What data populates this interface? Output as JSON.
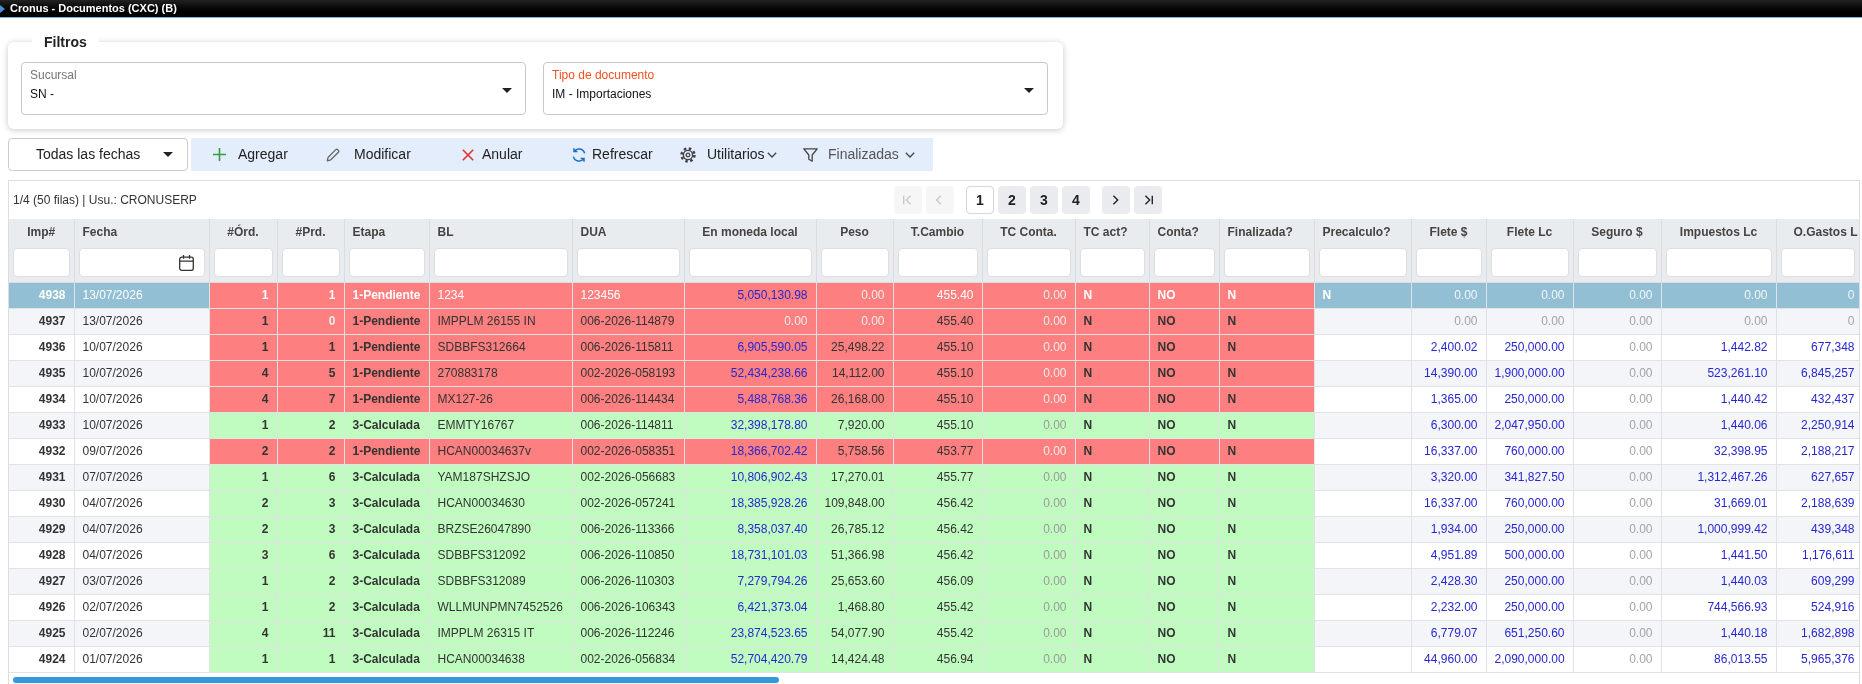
{
  "window": {
    "title": "Cronus - Documentos (CXC) (B)"
  },
  "filters": {
    "title": "Filtros",
    "fields": [
      {
        "label": "Sucursal",
        "value": "SN -",
        "focused": false
      },
      {
        "label": "Tipo de documento",
        "value": "IM - Importaciones",
        "focused": true
      }
    ]
  },
  "date_filter": {
    "value": "Todas las fechas"
  },
  "toolbar": [
    {
      "kind": "action",
      "label": "Agregar"
    },
    {
      "kind": "action",
      "label": "Modificar"
    },
    {
      "kind": "action",
      "label": "Anular"
    },
    {
      "kind": "action",
      "label": "Refrescar"
    },
    {
      "kind": "menu",
      "label": "Utilitarios"
    },
    {
      "kind": "filter",
      "label": "Finalizadas"
    }
  ],
  "table": {
    "info": "1/4 (50 filas) | Usu.: CRONUSERP",
    "pagination": {
      "first": {
        "disabled": true
      },
      "previous": {
        "disabled": true
      },
      "pages": [
        {
          "label": "1",
          "selected": true
        },
        {
          "label": "2",
          "selected": false
        },
        {
          "label": "3",
          "selected": false
        },
        {
          "label": "4",
          "selected": false
        }
      ],
      "next": {
        "disabled": false
      },
      "last": {
        "disabled": false
      }
    },
    "columns": [
      "Imp#",
      "Fecha",
      "#Órd.",
      "#Prd.",
      "Etapa",
      "BL",
      "DUA",
      "En moneda local",
      "Peso",
      "T.Cambio",
      "TC Conta.",
      "TC act?",
      "Conta?",
      "Finalizada?",
      "Precalculo?",
      "Flete $",
      "Flete Lc",
      "Seguro $",
      "Impuestos Lc",
      "O.Gastos L"
    ],
    "rows": [
      {
        "selected": true,
        "color": "#fd7f7f",
        "cells": [
          "4938",
          "13/07/2026",
          "1",
          "1",
          "1-Pendiente",
          "1234",
          "123456",
          "5,050,130.98",
          "0.00",
          "455.40",
          "0.00",
          "N",
          "NO",
          "N",
          "N",
          "0.00",
          "0.00",
          "0.00",
          "0.00",
          "0"
        ]
      },
      {
        "selected": false,
        "color": "#fd7f7f",
        "cells": [
          "4937",
          "13/07/2026",
          "1",
          "0",
          "1-Pendiente",
          "IMPPLM 26155 IN",
          "006-2026-114879",
          "0.00",
          "0.00",
          "455.40",
          "0.00",
          "N",
          "NO",
          "N",
          null,
          "0.00",
          "0.00",
          "0.00",
          "0.00",
          "0"
        ]
      },
      {
        "selected": false,
        "color": "#fd7f7f",
        "cells": [
          "4936",
          "10/07/2026",
          "1",
          "1",
          "1-Pendiente",
          "SDBBFS312664",
          "006-2026-115811",
          "6,905,590.05",
          "25,498.22",
          "455.10",
          "0.00",
          "N",
          "NO",
          "N",
          null,
          "2,400.02",
          "250,000.00",
          "0.00",
          "1,442.82",
          "677,348"
        ]
      },
      {
        "selected": false,
        "color": "#fd7f7f",
        "cells": [
          "4935",
          "10/07/2026",
          "4",
          "5",
          "1-Pendiente",
          "270883178",
          "002-2026-058193",
          "52,434,238.66",
          "14,112.00",
          "455.10",
          "0.00",
          "N",
          "NO",
          "N",
          null,
          "14,390.00",
          "1,900,000.00",
          "0.00",
          "523,261.10",
          "6,845,257"
        ]
      },
      {
        "selected": false,
        "color": "#fd7f7f",
        "cells": [
          "4934",
          "10/07/2026",
          "4",
          "7",
          "1-Pendiente",
          "MX127-26",
          "006-2026-114434",
          "5,488,768.36",
          "26,168.00",
          "455.10",
          "0.00",
          "N",
          "NO",
          "N",
          null,
          "1,365.00",
          "250,000.00",
          "0.00",
          "1,440.42",
          "432,437"
        ]
      },
      {
        "selected": false,
        "color": "#c0fcc0",
        "cells": [
          "4933",
          "10/07/2026",
          "1",
          "2",
          "3-Calculada",
          "EMMTY16767",
          "006-2026-114811",
          "32,398,178.80",
          "7,920.00",
          "455.10",
          "0.00",
          "N",
          "NO",
          "N",
          null,
          "6,300.00",
          "2,047,950.00",
          "0.00",
          "1,440.06",
          "2,250,914"
        ]
      },
      {
        "selected": false,
        "color": "#fd7f7f",
        "cells": [
          "4932",
          "09/07/2026",
          "2",
          "2",
          "1-Pendiente",
          "HCAN00034637v",
          "002-2026-058351",
          "18,366,702.42",
          "5,758.56",
          "453.77",
          "0.00",
          "N",
          "NO",
          "N",
          null,
          "16,337.00",
          "760,000.00",
          "0.00",
          "32,398.95",
          "2,188,217"
        ]
      },
      {
        "selected": false,
        "color": "#c0fcc0",
        "cells": [
          "4931",
          "07/07/2026",
          "1",
          "6",
          "3-Calculada",
          "YAM187SHZSJO",
          "002-2026-056683",
          "10,806,902.43",
          "17,270.01",
          "455.77",
          "0.00",
          "N",
          "NO",
          "N",
          null,
          "3,320.00",
          "341,827.50",
          "0.00",
          "1,312,467.26",
          "627,657"
        ]
      },
      {
        "selected": false,
        "color": "#c0fcc0",
        "cells": [
          "4930",
          "04/07/2026",
          "2",
          "3",
          "3-Calculada",
          "HCAN00034630",
          "002-2026-057241",
          "18,385,928.26",
          "109,848.00",
          "456.42",
          "0.00",
          "N",
          "NO",
          "N",
          null,
          "16,337.00",
          "760,000.00",
          "0.00",
          "31,669.01",
          "2,188,639"
        ]
      },
      {
        "selected": false,
        "color": "#c0fcc0",
        "cells": [
          "4929",
          "04/07/2026",
          "2",
          "3",
          "3-Calculada",
          "BRZSE26047890",
          "006-2026-113366",
          "8,358,037.40",
          "26,785.12",
          "456.42",
          "0.00",
          "N",
          "NO",
          "N",
          null,
          "1,934.00",
          "250,000.00",
          "0.00",
          "1,000,999.42",
          "439,348"
        ]
      },
      {
        "selected": false,
        "color": "#c0fcc0",
        "cells": [
          "4928",
          "04/07/2026",
          "3",
          "6",
          "3-Calculada",
          "SDBBFS312092",
          "006-2026-110850",
          "18,731,101.03",
          "51,366.98",
          "456.42",
          "0.00",
          "N",
          "NO",
          "N",
          null,
          "4,951.89",
          "500,000.00",
          "0.00",
          "1,441.50",
          "1,176,611"
        ]
      },
      {
        "selected": false,
        "color": "#c0fcc0",
        "cells": [
          "4927",
          "03/07/2026",
          "1",
          "2",
          "3-Calculada",
          "SDBBFS312089",
          "006-2026-110303",
          "7,279,794.26",
          "25,653.60",
          "456.09",
          "0.00",
          "N",
          "NO",
          "N",
          null,
          "2,428.30",
          "250,000.00",
          "0.00",
          "1,440.03",
          "609,299"
        ]
      },
      {
        "selected": false,
        "color": "#c0fcc0",
        "cells": [
          "4926",
          "02/07/2026",
          "1",
          "2",
          "3-Calculada",
          "WLLMUNPMN7452526",
          "006-2026-106343",
          "6,421,373.04",
          "1,468.80",
          "455.42",
          "0.00",
          "N",
          "NO",
          "N",
          null,
          "2,232.00",
          "250,000.00",
          "0.00",
          "744,566.93",
          "524,916"
        ]
      },
      {
        "selected": false,
        "color": "#c0fcc0",
        "cells": [
          "4925",
          "02/07/2026",
          "4",
          "11",
          "3-Calculada",
          "IMPPLM 26315 IT",
          "006-2026-112246",
          "23,874,523.65",
          "54,077.90",
          "455.42",
          "0.00",
          "N",
          "NO",
          "N",
          null,
          "6,779.07",
          "651,250.60",
          "0.00",
          "1,440.18",
          "1,682,898"
        ]
      },
      {
        "selected": false,
        "color": "#c0fcc0",
        "cells": [
          "4924",
          "01/07/2026",
          "1",
          "1",
          "3-Calculada",
          "HCAN00034638",
          "002-2026-056834",
          "52,704,420.79",
          "14,424.48",
          "456.94",
          "0.00",
          "N",
          "NO",
          "N",
          null,
          "44,960.00",
          "2,090,000.00",
          "0.00",
          "86,013.55",
          "5,965,376"
        ]
      }
    ]
  }
}
